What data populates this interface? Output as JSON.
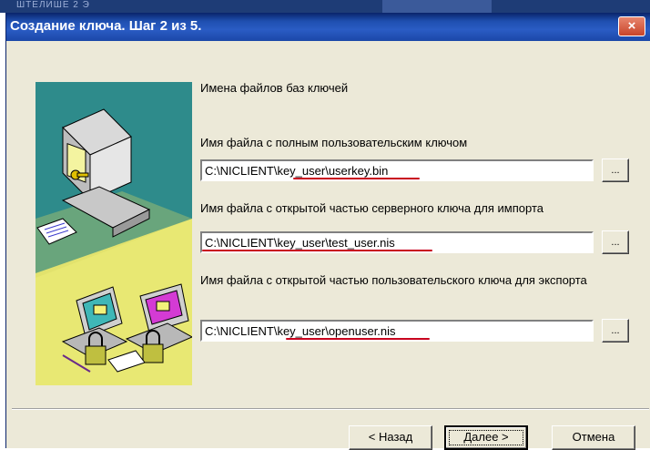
{
  "window": {
    "title": "Создание ключа. Шаг 2 из 5.",
    "close_symbol": "×"
  },
  "top_strip": {
    "partial_text": "ШТЕЛИШЕ 2 Э"
  },
  "form": {
    "heading": "Имена файлов баз ключей",
    "fields": [
      {
        "label": "Имя файла с полным пользовательским ключом",
        "value": "C:\\NICLIENT\\key_user\\userkey.bin",
        "browse_label": "..."
      },
      {
        "label": "Имя файла с открытой частью серверного ключа для импорта",
        "value": "C:\\NICLIENT\\key_user\\test_user.nis",
        "browse_label": "..."
      },
      {
        "label": "Имя файла с открытой частью пользовательского ключа для экспорта",
        "value": "C:\\NICLIENT\\key_user\\openuser.nis",
        "browse_label": "..."
      }
    ]
  },
  "buttons": {
    "back": "< Назад",
    "next": "Далее >",
    "cancel": "Отмена"
  },
  "colors": {
    "titlebar": "#1f4fb0",
    "annotation_underline": "#c8001e",
    "dialog_bg": "#ece9d8"
  },
  "icons": {
    "close": "close-icon",
    "wizard": "computer-keys-illustration"
  }
}
